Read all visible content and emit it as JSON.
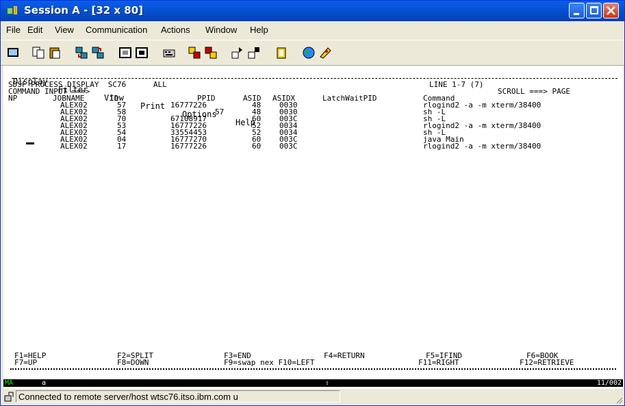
{
  "window": {
    "title": "Session A - [32 x 80]"
  },
  "menu": [
    "File",
    "Edit",
    "View",
    "Communication",
    "Actions",
    "Window",
    "Help"
  ],
  "toolbar": {
    "icons": [
      "display-icon",
      "copy-icon",
      "paste-icon",
      "send-icon",
      "receive-icon",
      "macro-icon",
      "screen-icon",
      "keyboard-icon",
      "color-icon",
      "record-icon",
      "play-icon",
      "stop-icon",
      "clipboard-icon",
      "globe-icon",
      "settings-icon"
    ]
  },
  "screen": {
    "action_bar": [
      "Display",
      "Filter",
      "View",
      "Print",
      "Options",
      "Help"
    ],
    "title_left": "SDSF PROCESS DISPLAY  SC76      ALL",
    "title_right": "LINE 1-7 (7)",
    "command_label": "COMMAND INPUT ===>",
    "scroll_label": "SCROLL ===> PAGE",
    "headers": {
      "np": "NP",
      "jobname": "JOBNAME",
      "id": "ID",
      "ppid": "PPID",
      "asid": "ASID",
      "asidx": "ASIDX",
      "latch": "LatchWaitPID",
      "command": "Command"
    },
    "rows": [
      {
        "jobname": "ALEX02",
        "id": "57",
        "ppid": "16777226",
        "asid": "48",
        "asidx": "0030",
        "command": "rlogind2 -a -m xterm/38400"
      },
      {
        "jobname": "ALEX02",
        "id": "58",
        "ppid": "57",
        "asid": "48",
        "asidx": "0030",
        "command": "sh -L"
      },
      {
        "jobname": "ALEX02",
        "id": "70",
        "ppid": "67108917",
        "asid": "60",
        "asidx": "003C",
        "command": "sh -L"
      },
      {
        "jobname": "ALEX02",
        "id": "53",
        "ppid": "16777226",
        "asid": "52",
        "asidx": "0034",
        "command": "rlogind2 -a -m xterm/38400"
      },
      {
        "jobname": "ALEX02",
        "id": "54",
        "ppid": "33554453",
        "asid": "52",
        "asidx": "0034",
        "command": "sh -L"
      },
      {
        "jobname": "ALEX02",
        "id": "04",
        "ppid": "16777270",
        "asid": "60",
        "asidx": "003C",
        "command": "java Main"
      },
      {
        "jobname": "ALEX02",
        "id": "17",
        "ppid": "16777226",
        "asid": "60",
        "asidx": "003C",
        "command": "rlogind2 -a -m xterm/38400"
      }
    ],
    "pf_row1": [
      "F1=HELP",
      "F2=SPLIT",
      "F3=END",
      "F4=RETURN",
      "F5=IFIND",
      "F6=BOOK"
    ],
    "pf_row2": [
      "F7=UP",
      "F8=DOWN",
      "F9=swap nex F10=LEFT",
      "F11=RIGHT",
      "F12=RETRIEVE"
    ]
  },
  "oia": {
    "mode": "MA",
    "session": "a",
    "cursor": "11/002"
  },
  "status": {
    "text": "Connected to remote server/host wtsc76.itso.ibm.com u"
  }
}
